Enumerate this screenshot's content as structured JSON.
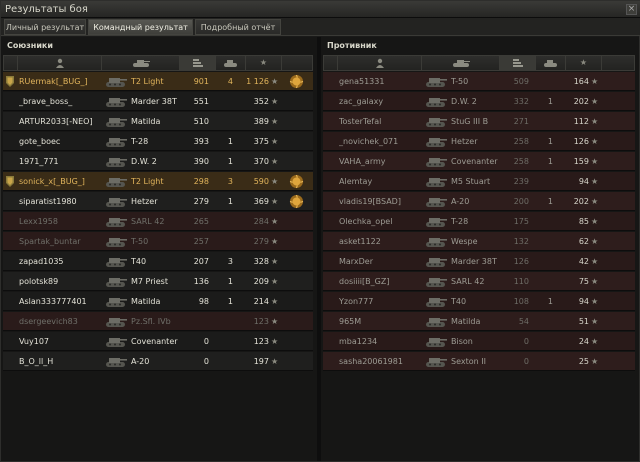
{
  "window": {
    "title": "Результаты боя",
    "close_glyph": "×"
  },
  "tabs": [
    {
      "label": "Личный результат",
      "active": false
    },
    {
      "label": "Командный результат",
      "active": true
    },
    {
      "label": "Подробный отчёт",
      "active": false
    }
  ],
  "allies": {
    "title": "Союзники",
    "rows": [
      {
        "player": "RUermak[_BUG_]",
        "tank": "T2 Light",
        "damage": "901",
        "kills": "4",
        "xp": "1 126",
        "style": "platoon",
        "medal": true
      },
      {
        "player": "_brave_boss_",
        "tank": "Marder 38T",
        "damage": "551",
        "kills": "",
        "xp": "352",
        "style": "alive",
        "medal": false
      },
      {
        "player": "ARTUR2033[-NEO]",
        "tank": "Matilda",
        "damage": "510",
        "kills": "",
        "xp": "389",
        "style": "alive",
        "medal": false
      },
      {
        "player": "gote_boec",
        "tank": "T-28",
        "damage": "393",
        "kills": "1",
        "xp": "375",
        "style": "alive",
        "medal": false
      },
      {
        "player": "1971_771",
        "tank": "D.W. 2",
        "damage": "390",
        "kills": "1",
        "xp": "370",
        "style": "alive",
        "medal": false
      },
      {
        "player": "sonick_x[_BUG_]",
        "tank": "T2 Light",
        "damage": "298",
        "kills": "3",
        "xp": "590",
        "style": "platoon",
        "medal": true
      },
      {
        "player": "siparatist1980",
        "tank": "Hetzer",
        "damage": "279",
        "kills": "1",
        "xp": "369",
        "style": "alive",
        "medal": true
      },
      {
        "player": "Lexx1958",
        "tank": "SARL 42",
        "damage": "265",
        "kills": "",
        "xp": "284",
        "style": "dead",
        "medal": false
      },
      {
        "player": "Spartak_buntar",
        "tank": "T-50",
        "damage": "257",
        "kills": "",
        "xp": "279",
        "style": "dead",
        "medal": false
      },
      {
        "player": "zapad1035",
        "tank": "T40",
        "damage": "207",
        "kills": "3",
        "xp": "328",
        "style": "alive",
        "medal": false
      },
      {
        "player": "polotsk89",
        "tank": "M7 Priest",
        "damage": "136",
        "kills": "1",
        "xp": "209",
        "style": "alive",
        "medal": false
      },
      {
        "player": "Aslan333777401",
        "tank": "Matilda",
        "damage": "98",
        "kills": "1",
        "xp": "214",
        "style": "alive",
        "medal": false
      },
      {
        "player": "dsergeevich83",
        "tank": "Pz.Sfl. IVb",
        "damage": "",
        "kills": "",
        "xp": "123",
        "style": "dead",
        "medal": false
      },
      {
        "player": "Vuy107",
        "tank": "Covenanter",
        "damage": "0",
        "kills": "",
        "xp": "123",
        "style": "alive",
        "medal": false
      },
      {
        "player": "B_O_ll_H",
        "tank": "A-20",
        "damage": "0",
        "kills": "",
        "xp": "197",
        "style": "alive",
        "medal": false
      }
    ]
  },
  "enemies": {
    "title": "Противник",
    "rows": [
      {
        "player": "gena51331",
        "tank": "T-50",
        "damage": "509",
        "kills": "",
        "xp": "164"
      },
      {
        "player": "zac_galaxy",
        "tank": "D.W. 2",
        "damage": "332",
        "kills": "1",
        "xp": "202"
      },
      {
        "player": "TosterTefal",
        "tank": "StuG III B",
        "damage": "271",
        "kills": "",
        "xp": "112"
      },
      {
        "player": "_novichek_071",
        "tank": "Hetzer",
        "damage": "258",
        "kills": "1",
        "xp": "126"
      },
      {
        "player": "VAHA_army",
        "tank": "Covenanter",
        "damage": "258",
        "kills": "1",
        "xp": "159"
      },
      {
        "player": "Alemtay",
        "tank": "M5 Stuart",
        "damage": "239",
        "kills": "",
        "xp": "94"
      },
      {
        "player": "vladis19[BSAD]",
        "tank": "A-20",
        "damage": "200",
        "kills": "1",
        "xp": "202"
      },
      {
        "player": "Olechka_opel",
        "tank": "T-28",
        "damage": "175",
        "kills": "",
        "xp": "85"
      },
      {
        "player": "asket1122",
        "tank": "Wespe",
        "damage": "132",
        "kills": "",
        "xp": "62"
      },
      {
        "player": "MarxDer",
        "tank": "Marder 38T",
        "damage": "126",
        "kills": "",
        "xp": "42"
      },
      {
        "player": "dosiiii[B_GZ]",
        "tank": "SARL 42",
        "damage": "110",
        "kills": "",
        "xp": "75"
      },
      {
        "player": "Yzon777",
        "tank": "T40",
        "damage": "108",
        "kills": "1",
        "xp": "94"
      },
      {
        "player": "965M",
        "tank": "Matilda",
        "damage": "54",
        "kills": "",
        "xp": "51"
      },
      {
        "player": "mba1234",
        "tank": "Bison",
        "damage": "0",
        "kills": "",
        "xp": "24"
      },
      {
        "player": "sasha20061981",
        "tank": "Sexton II",
        "damage": "0",
        "kills": "",
        "xp": "25"
      }
    ]
  },
  "colors": {
    "platoon": "#e0b45c",
    "alive": "#e4e3d8",
    "dead": "#6f6f69",
    "enemy": "#9d9c94",
    "ally_row": "#1f1f1e",
    "ally_row_alt": "#1b1b1a",
    "platoon_row": "#3a2c17",
    "dead_row": "#2a1b1a",
    "enemy_row": "#2e1d1c",
    "enemy_row_alt": "#291a19"
  },
  "icons": {
    "column_player": "person-icon",
    "column_tank": "tank-icon",
    "column_damage": "sort-arrow-icon",
    "column_kills": "destroyed-tank-icon",
    "column_xp": "star-icon"
  }
}
